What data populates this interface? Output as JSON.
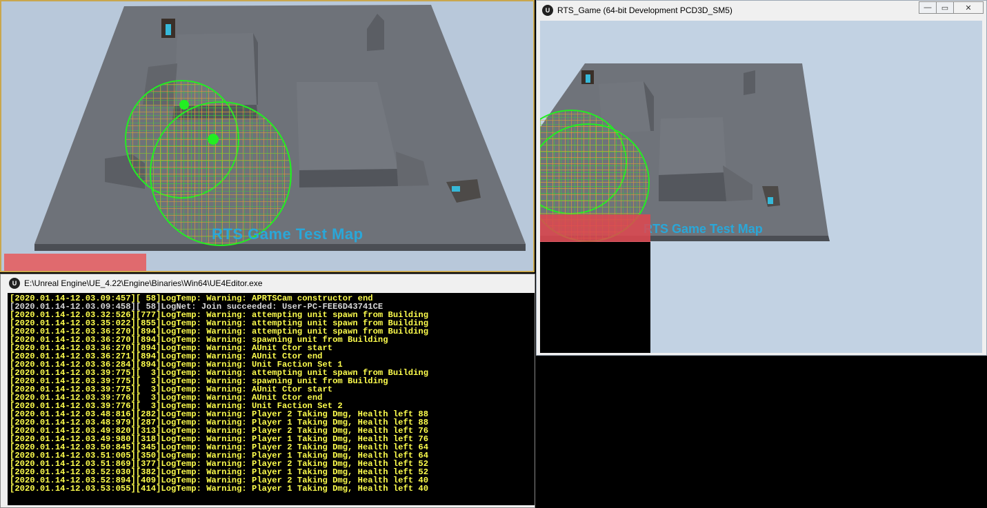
{
  "editor_viewport": {
    "map_label": "RTS Game Test Map"
  },
  "console": {
    "title": "E:\\Unreal Engine\\UE_4.22\\Engine\\Binaries\\Win64\\UE4Editor.exe",
    "lines": [
      "[2020.01.14-12.03.09:457][ 58]LogTemp: Warning: APRTSCam constructor end",
      "[2020.01.14-12.03.09:458][ 58]LogNet: Join succeeded: User-PC-FEE6D43741CE",
      "[2020.01.14-12.03.32:526][777]LogTemp: Warning: attempting unit spawn from Building",
      "[2020.01.14-12.03.35:022][855]LogTemp: Warning: attempting unit spawn from Building",
      "[2020.01.14-12.03.36:270][894]LogTemp: Warning: attempting unit spawn from Building",
      "[2020.01.14-12.03.36:270][894]LogTemp: Warning: spawning unit from Building",
      "[2020.01.14-12.03.36:270][894]LogTemp: Warning: AUnit Ctor start",
      "[2020.01.14-12.03.36:271][894]LogTemp: Warning: AUnit Ctor end",
      "[2020.01.14-12.03.36:284][894]LogTemp: Warning: Unit Faction Set 1",
      "[2020.01.14-12.03.39:775][  3]LogTemp: Warning: attempting unit spawn from Building",
      "[2020.01.14-12.03.39:775][  3]LogTemp: Warning: spawning unit from Building",
      "[2020.01.14-12.03.39:775][  3]LogTemp: Warning: AUnit Ctor start",
      "[2020.01.14-12.03.39:776][  3]LogTemp: Warning: AUnit Ctor end",
      "[2020.01.14-12.03.39:776][  3]LogTemp: Warning: Unit Faction Set 2",
      "[2020.01.14-12.03.48:816][282]LogTemp: Warning: Player 2 Taking Dmg, Health left 88",
      "[2020.01.14-12.03.48:979][287]LogTemp: Warning: Player 1 Taking Dmg, Health left 88",
      "[2020.01.14-12.03.49:820][313]LogTemp: Warning: Player 2 Taking Dmg, Health left 76",
      "[2020.01.14-12.03.49:980][318]LogTemp: Warning: Player 1 Taking Dmg, Health left 76",
      "[2020.01.14-12.03.50:845][345]LogTemp: Warning: Player 2 Taking Dmg, Health left 64",
      "[2020.01.14-12.03.51:005][350]LogTemp: Warning: Player 1 Taking Dmg, Health left 64",
      "[2020.01.14-12.03.51:869][377]LogTemp: Warning: Player 2 Taking Dmg, Health left 52",
      "[2020.01.14-12.03.52:030][382]LogTemp: Warning: Player 1 Taking Dmg, Health left 52",
      "[2020.01.14-12.03.52:894][409]LogTemp: Warning: Player 2 Taking Dmg, Health left 40",
      "[2020.01.14-12.03.53:055][414]LogTemp: Warning: Player 1 Taking Dmg, Health left 40"
    ]
  },
  "game_window": {
    "title": "RTS_Game (64-bit Development PCD3D_SM5)",
    "map_label": "RTS Game Test Map",
    "controls": {
      "minimize": "—",
      "maximize": "▭",
      "close": "✕"
    }
  },
  "colors": {
    "warning_text": "#ffff4d",
    "plain_text": "#d8d8d8",
    "console_bg": "#000000",
    "map_label": "#2aa7d8",
    "hud_bar": "#e06a6e",
    "editor_border": "#c9a74d",
    "sky": "#b8c8da",
    "floor": "#6f737a",
    "sphere_outer": "#22ee22",
    "sphere_inner": "#e23a1f"
  },
  "icons": {
    "ue_logo": "unreal-logo-icon"
  }
}
